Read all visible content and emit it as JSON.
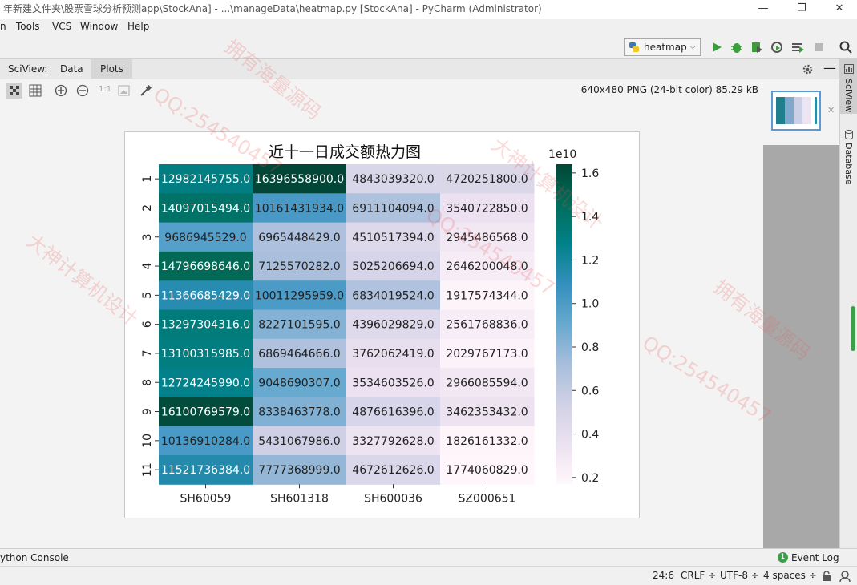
{
  "window": {
    "title": "年新建文件夹\\股票雪球分析预测app\\StockAna] - ...\\manageData\\heatmap.py [StockAna] - PyCharm (Administrator)",
    "controls": [
      "—",
      "❐",
      "✕"
    ]
  },
  "menu": {
    "items": [
      "n",
      "Tools",
      "VCS",
      "Window",
      "Help"
    ]
  },
  "toolbar": {
    "run_config": "heatmap"
  },
  "sciview": {
    "label": "SciView:",
    "tabs": [
      "Data",
      "Plots"
    ],
    "active_tab": "Plots",
    "zoom_label": "1:1",
    "image_info": "640x480 PNG (24-bit color) 85.29 kB"
  },
  "right_strip": {
    "sciview_label": "SciView",
    "database_label": "Database"
  },
  "chart_data": {
    "type": "heatmap",
    "title": "近十一日成交额热力图",
    "columns": [
      "SH60059",
      "SH601318",
      "SH600036",
      "SZ000651"
    ],
    "rows": [
      "1",
      "2",
      "3",
      "4",
      "5",
      "6",
      "7",
      "8",
      "9",
      "10",
      "11"
    ],
    "values": [
      [
        "12982145755.0",
        "16396558900.0",
        "4843039320.0",
        "4720251800.0"
      ],
      [
        "14097015494.0",
        "10161431934.0",
        "6911104094.0",
        "3540722850.0"
      ],
      [
        "9686945529.0",
        "6965448429.0",
        "4510517394.0",
        "2945486568.0"
      ],
      [
        "14796698646.0",
        "7125570282.0",
        "5025206694.0",
        "2646200048.0"
      ],
      [
        "11366685429.0",
        "10011295959.0",
        "6834019524.0",
        "1917574344.0"
      ],
      [
        "13297304316.0",
        "8227101595.0",
        "4396029829.0",
        "2561768836.0"
      ],
      [
        "13100315985.0",
        "6869464666.0",
        "3762062419.0",
        "2029767173.0"
      ],
      [
        "12724245990.0",
        "9048690307.0",
        "3534603526.0",
        "2966085594.0"
      ],
      [
        "16100769579.0",
        "8338463778.0",
        "4876616396.0",
        "3462353432.0"
      ],
      [
        "10136910284.0",
        "5431067986.0",
        "3327792628.0",
        "1826161332.0"
      ],
      [
        "11521736384.0",
        "7777368999.0",
        "4672612626.0",
        "1774060829.0"
      ]
    ],
    "colorbar": {
      "exponent_label": "1e10",
      "ticks": [
        "0.2",
        "0.4",
        "0.6",
        "0.8",
        "1.0",
        "1.2",
        "1.4",
        "1.6"
      ],
      "tick_values": [
        0.2,
        0.4,
        0.6,
        0.8,
        1.0,
        1.2,
        1.4,
        1.6
      ],
      "range": [
        0.17,
        1.64
      ],
      "colormap": "PuBuGn"
    }
  },
  "watermarks": [
    "QQ:254540457",
    "拥有海量源码",
    "大神计算机设计"
  ],
  "toolwindows": {
    "python_console": "ython Console",
    "event_log": "Event Log",
    "event_count": "1"
  },
  "status": {
    "position": "24:6",
    "line_sep": "CRLF ÷",
    "encoding": "UTF-8 ÷",
    "indent": "4 spaces ÷"
  }
}
